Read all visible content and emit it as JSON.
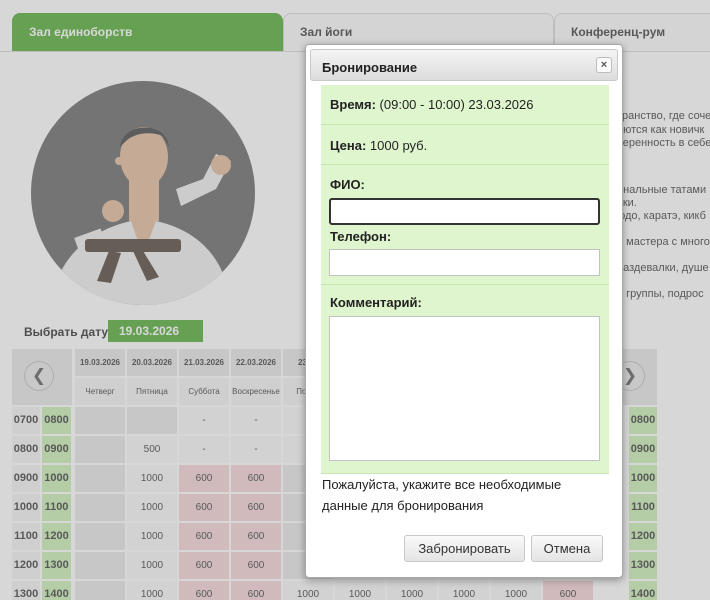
{
  "tabs": [
    {
      "label": "Зал единоборств"
    },
    {
      "label": "Зал йоги"
    },
    {
      "label": "Конференц-рум"
    }
  ],
  "background": {
    "date_label": "Выбрать дату:",
    "selected_date": "19.03.2026",
    "description_lines": [
      "транство, где соче",
      "аются как новичк",
      "веренность в себе",
      "ональные татами",
      "вки.",
      "юдо, каратэ, кикб",
      "е мастера с много",
      "раздевалки, душе",
      "е группы, подрос"
    ]
  },
  "schedule": {
    "dates": [
      "19.03.2026",
      "20.03.2026",
      "21.03.2026",
      "22.03.2026",
      "23.03"
    ],
    "weekdays": [
      "Четверг",
      "Пятница",
      "Суббота",
      "Воскресенье",
      "Понед"
    ],
    "left_slots": [
      {
        "start": "07",
        "end": "08"
      },
      {
        "start": "08",
        "end": "09"
      },
      {
        "start": "09",
        "end": "10"
      },
      {
        "start": "10",
        "end": "11"
      },
      {
        "start": "11",
        "end": "12"
      },
      {
        "start": "12",
        "end": "13"
      },
      {
        "start": "13",
        "end": "14"
      }
    ],
    "minutes": "00",
    "rows": [
      [
        "",
        "",
        "-",
        "-",
        "-"
      ],
      [
        "",
        "500",
        "-",
        "-",
        "5"
      ],
      [
        "",
        "1000",
        "600",
        "600",
        ""
      ],
      [
        "",
        "1000",
        "600",
        "600",
        ""
      ],
      [
        "",
        "1000",
        "600",
        "600",
        ""
      ],
      [
        "",
        "1000",
        "600",
        "600",
        ""
      ],
      [
        "",
        "1000",
        "600",
        "600",
        "1000"
      ]
    ],
    "extra_last_row": [
      "1000",
      "1000",
      "1000",
      "1000",
      "600"
    ],
    "right_slots": [
      "08",
      "09",
      "10",
      "11",
      "12",
      "13",
      "14"
    ]
  },
  "dialog": {
    "title": "Бронирование",
    "close_label": "×",
    "time_label": "Время:",
    "time_value": "(09:00 - 10:00) 23.03.2026",
    "price_label": "Цена:",
    "price_value": "1000 руб.",
    "fio_label": "ФИО:",
    "fio_value": "",
    "phone_label": "Телефон:",
    "phone_value": "",
    "comment_label": "Комментарий:",
    "comment_value": "",
    "message": "Пожалуйста, укажите все необходимые данные для бронирования",
    "book_button": "Забронировать",
    "cancel_button": "Отмена"
  },
  "colors": {
    "accent": "#4aa62a",
    "section_bg": "#dff5ce",
    "slot_green": "#c7efb1",
    "price_pink": "#f4d0d3",
    "cell_gray": "#e6e6e6"
  },
  "icons": {
    "prev": "arrow-left-icon",
    "next": "arrow-right-icon",
    "close": "close-icon"
  }
}
